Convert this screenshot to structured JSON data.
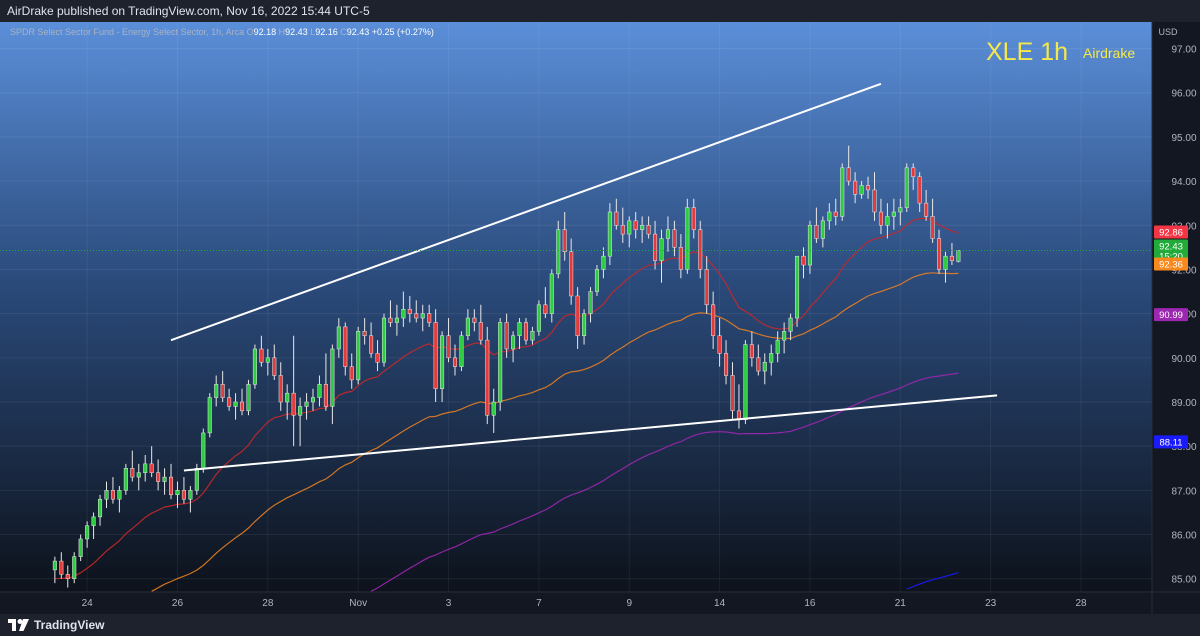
{
  "header": {
    "published": "AirDrake published on TradingView.com, Nov 16, 2022 15:44 UTC-5"
  },
  "footer": {
    "brand": "TradingView"
  },
  "chart_data": {
    "type": "candlestick",
    "legend": {
      "symbol": "SPDR Select Sector Fund - Energy Select Sector, 1h, Arca",
      "o_label": "O",
      "o": "92.18",
      "h_label": "H",
      "h": "92.43",
      "l_label": "L",
      "l": "92.16",
      "c_label": "C",
      "c": "92.43",
      "change": "+0.25 (+0.27%)"
    },
    "watermark_title": "XLE 1h",
    "watermark_author": "Airdrake",
    "currency": "USD",
    "ylim": [
      84.7,
      97.6
    ],
    "y_ticks": [
      "85.00",
      "86.00",
      "87.00",
      "88.00",
      "89.00",
      "90.00",
      "91.00",
      "92.00",
      "93.00",
      "94.00",
      "95.00",
      "96.00",
      "97.00"
    ],
    "x_ticks": [
      {
        "label": "24",
        "x": 5
      },
      {
        "label": "26",
        "x": 19
      },
      {
        "label": "28",
        "x": 33
      },
      {
        "label": "Nov",
        "x": 47
      },
      {
        "label": "3",
        "x": 61
      },
      {
        "label": "7",
        "x": 75
      },
      {
        "label": "9",
        "x": 89
      },
      {
        "label": "14",
        "x": 103
      },
      {
        "label": "16",
        "x": 117
      },
      {
        "label": "21",
        "x": 131
      },
      {
        "label": "23",
        "x": 145
      },
      {
        "label": "28",
        "x": 159
      }
    ],
    "x_range": [
      -8.5,
      170
    ],
    "price_labels": [
      {
        "value": "92.86",
        "color": "#f23645"
      },
      {
        "value": "92.43",
        "color": "#22ab3a"
      },
      {
        "value": "15:20",
        "color": "#22ab3a"
      },
      {
        "value": "92.36",
        "color": "#f7891e"
      },
      {
        "value": "90.99",
        "color": "#9c27b0"
      },
      {
        "value": "88.11",
        "color": "#1a1aff"
      }
    ],
    "last_price": 92.43,
    "trendlines": [
      {
        "from": [
          18,
          90.4
        ],
        "to": [
          128,
          96.2
        ],
        "color": "#ffffff"
      },
      {
        "from": [
          20,
          87.45
        ],
        "to": [
          146,
          89.15
        ],
        "color": "#ffffff"
      }
    ],
    "candles": [
      [
        85.2,
        85.5,
        84.9,
        85.4
      ],
      [
        85.4,
        85.6,
        85.0,
        85.1
      ],
      [
        85.1,
        85.3,
        84.8,
        85.0
      ],
      [
        85.0,
        85.6,
        84.9,
        85.5
      ],
      [
        85.5,
        86.0,
        85.4,
        85.9
      ],
      [
        85.9,
        86.3,
        85.7,
        86.2
      ],
      [
        86.2,
        86.5,
        85.9,
        86.4
      ],
      [
        86.4,
        86.9,
        86.2,
        86.8
      ],
      [
        86.8,
        87.2,
        86.6,
        87.0
      ],
      [
        87.0,
        87.3,
        86.7,
        86.8
      ],
      [
        86.8,
        87.1,
        86.5,
        87.0
      ],
      [
        87.0,
        87.6,
        86.9,
        87.5
      ],
      [
        87.5,
        87.9,
        87.2,
        87.3
      ],
      [
        87.3,
        87.6,
        87.0,
        87.4
      ],
      [
        87.4,
        87.8,
        87.2,
        87.6
      ],
      [
        87.6,
        88.0,
        87.3,
        87.4
      ],
      [
        87.4,
        87.7,
        87.0,
        87.2
      ],
      [
        87.2,
        87.5,
        86.9,
        87.3
      ],
      [
        87.3,
        87.6,
        86.8,
        86.9
      ],
      [
        86.9,
        87.2,
        86.6,
        87.0
      ],
      [
        87.0,
        87.3,
        86.7,
        86.8
      ],
      [
        86.8,
        87.1,
        86.5,
        87.0
      ],
      [
        87.0,
        87.6,
        86.9,
        87.5
      ],
      [
        87.5,
        88.4,
        87.4,
        88.3
      ],
      [
        88.3,
        89.2,
        88.2,
        89.1
      ],
      [
        89.1,
        89.6,
        88.9,
        89.4
      ],
      [
        89.4,
        89.7,
        89.0,
        89.1
      ],
      [
        89.1,
        89.3,
        88.8,
        88.9
      ],
      [
        88.9,
        89.2,
        88.6,
        89.0
      ],
      [
        89.0,
        89.3,
        88.7,
        88.8
      ],
      [
        88.8,
        89.5,
        88.7,
        89.4
      ],
      [
        89.4,
        90.3,
        89.3,
        90.2
      ],
      [
        90.2,
        90.5,
        89.8,
        89.9
      ],
      [
        89.9,
        90.2,
        89.6,
        90.0
      ],
      [
        90.0,
        90.3,
        89.5,
        89.6
      ],
      [
        89.6,
        89.9,
        88.8,
        89.0
      ],
      [
        89.0,
        89.4,
        88.6,
        89.2
      ],
      [
        89.2,
        90.5,
        88.0,
        88.7
      ],
      [
        88.7,
        89.1,
        88.0,
        88.9
      ],
      [
        88.9,
        89.2,
        88.6,
        89.0
      ],
      [
        89.0,
        89.3,
        88.8,
        89.1
      ],
      [
        89.1,
        89.6,
        88.9,
        89.4
      ],
      [
        89.4,
        90.1,
        88.8,
        88.9
      ],
      [
        88.9,
        90.3,
        88.5,
        90.2
      ],
      [
        90.2,
        90.9,
        90.0,
        90.7
      ],
      [
        90.7,
        90.8,
        89.6,
        89.8
      ],
      [
        89.8,
        90.1,
        89.3,
        89.5
      ],
      [
        89.5,
        90.7,
        89.4,
        90.6
      ],
      [
        90.6,
        90.9,
        90.3,
        90.5
      ],
      [
        90.5,
        90.8,
        90.0,
        90.1
      ],
      [
        90.1,
        90.4,
        89.7,
        89.9
      ],
      [
        89.9,
        91.0,
        89.8,
        90.9
      ],
      [
        90.9,
        91.3,
        90.7,
        90.8
      ],
      [
        90.8,
        91.2,
        90.5,
        90.9
      ],
      [
        90.9,
        91.5,
        90.7,
        91.1
      ],
      [
        91.1,
        91.4,
        90.8,
        91.0
      ],
      [
        91.0,
        91.3,
        90.8,
        90.9
      ],
      [
        90.9,
        91.2,
        90.6,
        91.0
      ],
      [
        91.0,
        91.2,
        90.7,
        90.8
      ],
      [
        90.8,
        91.1,
        89.0,
        89.3
      ],
      [
        89.3,
        90.6,
        89.0,
        90.5
      ],
      [
        90.5,
        90.9,
        89.9,
        90.0
      ],
      [
        90.0,
        90.3,
        89.6,
        89.8
      ],
      [
        89.8,
        90.6,
        89.7,
        90.5
      ],
      [
        90.5,
        91.1,
        90.4,
        90.9
      ],
      [
        90.9,
        91.1,
        90.6,
        90.8
      ],
      [
        90.8,
        91.2,
        90.3,
        90.4
      ],
      [
        90.4,
        90.7,
        88.5,
        88.7
      ],
      [
        88.7,
        89.3,
        88.3,
        89.0
      ],
      [
        89.0,
        90.9,
        88.8,
        90.8
      ],
      [
        90.8,
        91.0,
        90.0,
        90.2
      ],
      [
        90.2,
        90.6,
        89.9,
        90.5
      ],
      [
        90.5,
        90.9,
        90.2,
        90.8
      ],
      [
        90.8,
        90.9,
        90.3,
        90.4
      ],
      [
        90.4,
        90.7,
        90.3,
        90.6
      ],
      [
        90.6,
        91.3,
        90.5,
        91.2
      ],
      [
        91.2,
        91.6,
        90.9,
        91.0
      ],
      [
        91.0,
        92.0,
        90.8,
        91.9
      ],
      [
        91.9,
        93.1,
        91.8,
        92.9
      ],
      [
        92.9,
        93.3,
        92.2,
        92.4
      ],
      [
        92.4,
        92.7,
        91.2,
        91.4
      ],
      [
        91.4,
        91.6,
        90.2,
        90.5
      ],
      [
        90.5,
        91.1,
        90.3,
        91.0
      ],
      [
        91.0,
        91.6,
        90.8,
        91.5
      ],
      [
        91.5,
        92.1,
        91.4,
        92.0
      ],
      [
        92.0,
        92.5,
        91.8,
        92.3
      ],
      [
        92.3,
        93.5,
        92.1,
        93.3
      ],
      [
        93.3,
        93.6,
        92.9,
        93.0
      ],
      [
        93.0,
        93.4,
        92.6,
        92.8
      ],
      [
        92.8,
        93.2,
        92.5,
        93.1
      ],
      [
        93.1,
        93.3,
        92.7,
        92.9
      ],
      [
        92.9,
        93.2,
        92.6,
        93.0
      ],
      [
        93.0,
        93.2,
        92.7,
        92.8
      ],
      [
        92.8,
        93.1,
        92.0,
        92.2
      ],
      [
        92.2,
        92.9,
        91.7,
        92.7
      ],
      [
        92.7,
        93.2,
        92.4,
        92.9
      ],
      [
        92.9,
        93.1,
        92.3,
        92.5
      ],
      [
        92.5,
        92.8,
        91.8,
        92.0
      ],
      [
        92.0,
        93.6,
        91.9,
        93.4
      ],
      [
        93.4,
        93.6,
        92.7,
        92.9
      ],
      [
        92.9,
        93.1,
        91.8,
        92.0
      ],
      [
        92.0,
        92.3,
        91.0,
        91.2
      ],
      [
        91.2,
        91.5,
        90.2,
        90.5
      ],
      [
        90.5,
        90.9,
        89.8,
        90.1
      ],
      [
        90.1,
        90.4,
        89.4,
        89.6
      ],
      [
        89.6,
        89.9,
        88.6,
        88.8
      ],
      [
        88.8,
        89.4,
        88.4,
        88.6
      ],
      [
        88.6,
        90.4,
        88.5,
        90.3
      ],
      [
        90.3,
        90.6,
        89.8,
        90.0
      ],
      [
        90.0,
        90.3,
        89.6,
        89.7
      ],
      [
        89.7,
        90.1,
        89.4,
        89.9
      ],
      [
        89.9,
        90.3,
        89.6,
        90.1
      ],
      [
        90.1,
        90.6,
        89.9,
        90.4
      ],
      [
        90.4,
        90.8,
        90.1,
        90.6
      ],
      [
        90.6,
        91.0,
        90.4,
        90.9
      ],
      [
        90.9,
        92.0,
        90.7,
        92.3
      ],
      [
        92.3,
        92.5,
        91.8,
        92.1
      ],
      [
        92.1,
        93.1,
        91.9,
        93.0
      ],
      [
        93.0,
        93.4,
        92.6,
        92.7
      ],
      [
        92.7,
        93.2,
        92.5,
        93.1
      ],
      [
        93.1,
        93.5,
        92.9,
        93.3
      ],
      [
        93.3,
        93.6,
        93.0,
        93.2
      ],
      [
        93.2,
        94.4,
        93.1,
        94.3
      ],
      [
        94.3,
        94.8,
        93.9,
        94.0
      ],
      [
        94.0,
        94.2,
        93.5,
        93.7
      ],
      [
        93.7,
        94.0,
        93.6,
        93.9
      ],
      [
        93.9,
        94.1,
        93.6,
        93.8
      ],
      [
        93.8,
        94.2,
        93.1,
        93.3
      ],
      [
        93.3,
        93.6,
        92.8,
        93.0
      ],
      [
        93.0,
        93.5,
        92.7,
        93.2
      ],
      [
        93.2,
        93.6,
        92.9,
        93.3
      ],
      [
        93.3,
        93.6,
        93.0,
        93.4
      ],
      [
        93.4,
        94.4,
        93.3,
        94.3
      ],
      [
        94.3,
        94.4,
        93.8,
        94.1
      ],
      [
        94.1,
        94.2,
        93.3,
        93.5
      ],
      [
        93.5,
        93.8,
        93.1,
        93.2
      ],
      [
        93.2,
        93.6,
        92.6,
        92.7
      ],
      [
        92.7,
        92.9,
        91.9,
        92.0
      ],
      [
        92.0,
        92.4,
        91.7,
        92.3
      ],
      [
        92.3,
        92.6,
        92.1,
        92.2
      ],
      [
        92.18,
        92.43,
        92.16,
        92.43
      ]
    ],
    "ma_series": [
      {
        "name": "MA20",
        "color": "#c62828",
        "period": 20
      },
      {
        "name": "MA50",
        "color": "#e67e22",
        "period": 50
      },
      {
        "name": "MA100",
        "color": "#9c27b0",
        "period": 100
      },
      {
        "name": "MA200",
        "color": "#1a1aff",
        "period": 200
      }
    ]
  }
}
